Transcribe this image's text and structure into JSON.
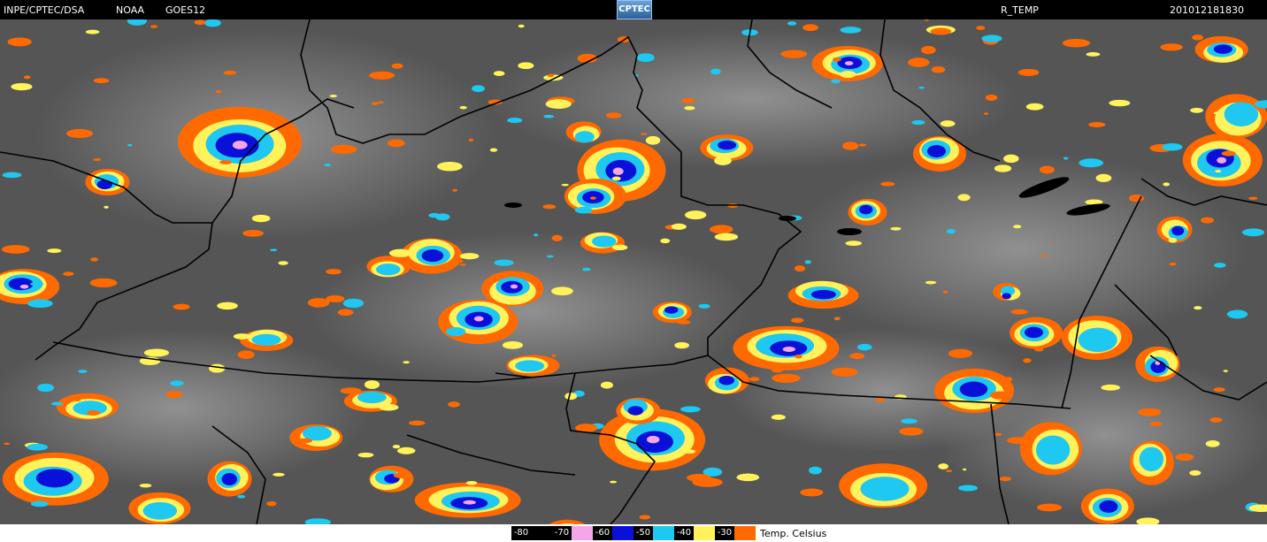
{
  "header": {
    "source": "INPE/CPTEC/DSA",
    "agency": "NOAA",
    "satellite": "GOES12",
    "product": "R_TEMP",
    "timestamp": "201012181830",
    "logo_text": "CPTEC"
  },
  "legend": {
    "items": [
      {
        "label": "-80",
        "color": "#000000"
      },
      {
        "label": "-70",
        "color": "#f4a6e8"
      },
      {
        "label": "-60",
        "color": "#0a10d8"
      },
      {
        "label": "-50",
        "color": "#1ec8f0"
      },
      {
        "label": "-40",
        "color": "#fff25a"
      },
      {
        "label": "-30",
        "color": "#ff6a00"
      }
    ],
    "unit": "Temp. Celsius"
  },
  "colors": {
    "background": "#5a5a5a",
    "border": "#000000"
  }
}
